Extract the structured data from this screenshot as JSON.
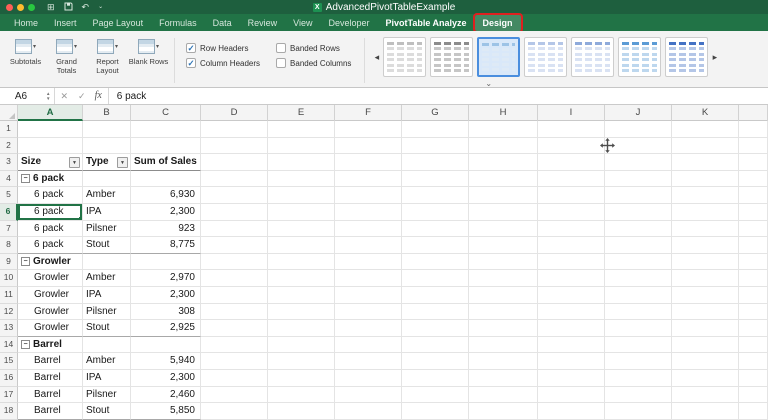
{
  "titlebar": {
    "title": "AdvancedPivotTableExample"
  },
  "tabs": [
    {
      "label": "Home"
    },
    {
      "label": "Insert"
    },
    {
      "label": "Page Layout"
    },
    {
      "label": "Formulas"
    },
    {
      "label": "Data"
    },
    {
      "label": "Review"
    },
    {
      "label": "View"
    },
    {
      "label": "Developer"
    },
    {
      "label": "PivotTable Analyze",
      "contextual": true
    },
    {
      "label": "Design",
      "contextual": true,
      "active": true,
      "annotated": true
    }
  ],
  "ribbon": {
    "buttons": [
      {
        "label": "Subtotals"
      },
      {
        "label": "Grand Totals"
      },
      {
        "label": "Report Layout"
      },
      {
        "label": "Blank Rows"
      }
    ],
    "checkboxes": [
      {
        "label": "Row Headers",
        "checked": true
      },
      {
        "label": "Column Headers",
        "checked": true
      },
      {
        "label": "Banded Rows",
        "checked": false
      },
      {
        "label": "Banded Columns",
        "checked": false
      }
    ],
    "gallery": {
      "styles": [
        {
          "name": "PivotStyle Light 1",
          "header": "#bfbfbf",
          "row": "#dcdcdc",
          "selected": false
        },
        {
          "name": "PivotStyle Light 2",
          "header": "#8c8c8c",
          "row": "#c6c6c6",
          "selected": false
        },
        {
          "name": "PivotStyle Light 3",
          "header": "#9dc3e6",
          "row": "#deeaf6",
          "selected": true
        },
        {
          "name": "PivotStyle Light 4",
          "header": "#b4c6e7",
          "row": "#d9e2f3",
          "selected": false
        },
        {
          "name": "PivotStyle Light 5",
          "header": "#8eaadb",
          "row": "#d9e2f3",
          "selected": false
        },
        {
          "name": "PivotStyle Light 6",
          "header": "#5b9bd5",
          "row": "#bdd7ee",
          "selected": false
        },
        {
          "name": "PivotStyle Light 7",
          "header": "#4472c4",
          "row": "#b4c6e7",
          "selected": false
        }
      ]
    }
  },
  "formula_bar": {
    "cell_ref": "A6",
    "fx_label": "fx",
    "value": "6 pack"
  },
  "sheet": {
    "columns": [
      "A",
      "B",
      "C",
      "D",
      "E",
      "F",
      "G",
      "H",
      "I",
      "J",
      "K"
    ],
    "selected": {
      "cell": "A6",
      "col": "A",
      "row": 6
    },
    "rows": [
      {
        "n": 1
      },
      {
        "n": 2
      },
      {
        "n": 3,
        "type": "header",
        "a": "Size",
        "b": "Type",
        "c": "Sum of Sales"
      },
      {
        "n": 4,
        "type": "group",
        "a": "6 pack"
      },
      {
        "n": 5,
        "a": "6 pack",
        "b": "Amber",
        "c": "6,930"
      },
      {
        "n": 6,
        "a": "6 pack",
        "b": "IPA",
        "c": "2,300",
        "selected": true
      },
      {
        "n": 7,
        "a": "6 pack",
        "b": "Pilsner",
        "c": "923"
      },
      {
        "n": 8,
        "a": "6 pack",
        "b": "Stout",
        "c": "8,775",
        "groupEnd": true
      },
      {
        "n": 9,
        "type": "group",
        "a": "Growler"
      },
      {
        "n": 10,
        "a": "Growler",
        "b": "Amber",
        "c": "2,970"
      },
      {
        "n": 11,
        "a": "Growler",
        "b": "IPA",
        "c": "2,300"
      },
      {
        "n": 12,
        "a": "Growler",
        "b": "Pilsner",
        "c": "308"
      },
      {
        "n": 13,
        "a": "Growler",
        "b": "Stout",
        "c": "2,925",
        "groupEnd": true
      },
      {
        "n": 14,
        "type": "group",
        "a": "Barrel"
      },
      {
        "n": 15,
        "a": "Barrel",
        "b": "Amber",
        "c": "5,940"
      },
      {
        "n": 16,
        "a": "Barrel",
        "b": "IPA",
        "c": "2,300"
      },
      {
        "n": 17,
        "a": "Barrel",
        "b": "Pilsner",
        "c": "2,460"
      },
      {
        "n": 18,
        "a": "Barrel",
        "b": "Stout",
        "c": "5,850",
        "groupEnd": true
      }
    ]
  },
  "icons": {
    "dropdown": "▾",
    "filter": "▼",
    "minus": "−",
    "cancel": "✕",
    "enter": "✓",
    "up": "▲",
    "down": "▼",
    "left": "◂",
    "right": "▸",
    "grid": "⊞",
    "undo": "↶",
    "chevron": "⌄"
  },
  "colors": {
    "excel_green": "#217346",
    "annotation_red": "#e01f1f",
    "selection_blue": "#4a8ede"
  }
}
